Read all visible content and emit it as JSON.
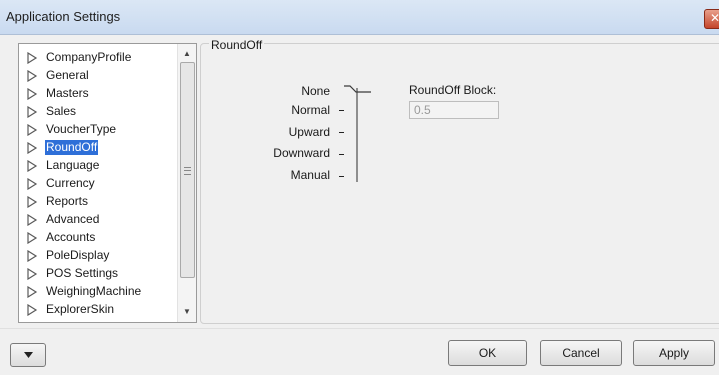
{
  "window": {
    "title": "Application Settings",
    "close_glyph": "✕"
  },
  "tree": {
    "items": [
      {
        "label": "CompanyProfile",
        "selected": false
      },
      {
        "label": "General",
        "selected": false
      },
      {
        "label": "Masters",
        "selected": false
      },
      {
        "label": "Sales",
        "selected": false
      },
      {
        "label": "VoucherType",
        "selected": false
      },
      {
        "label": "RoundOff",
        "selected": true
      },
      {
        "label": "Language",
        "selected": false
      },
      {
        "label": "Currency",
        "selected": false
      },
      {
        "label": "Reports",
        "selected": false
      },
      {
        "label": "Advanced",
        "selected": false
      },
      {
        "label": "Accounts",
        "selected": false
      },
      {
        "label": "PoleDisplay",
        "selected": false
      },
      {
        "label": "POS Settings",
        "selected": false
      },
      {
        "label": "WeighingMachine",
        "selected": false
      },
      {
        "label": "ExplorerSkin",
        "selected": false
      }
    ]
  },
  "roundoff": {
    "group_title": "RoundOff",
    "options": [
      "None",
      "Normal",
      "Upward",
      "Downward",
      "Manual"
    ],
    "selected_option": "None",
    "block_label": "RoundOff Block:",
    "block_value": "0.5"
  },
  "buttons": {
    "ok": "OK",
    "cancel": "Cancel",
    "apply": "Apply"
  },
  "colors": {
    "selection": "#2e6fd8",
    "titlebar": "#c9daf0"
  }
}
